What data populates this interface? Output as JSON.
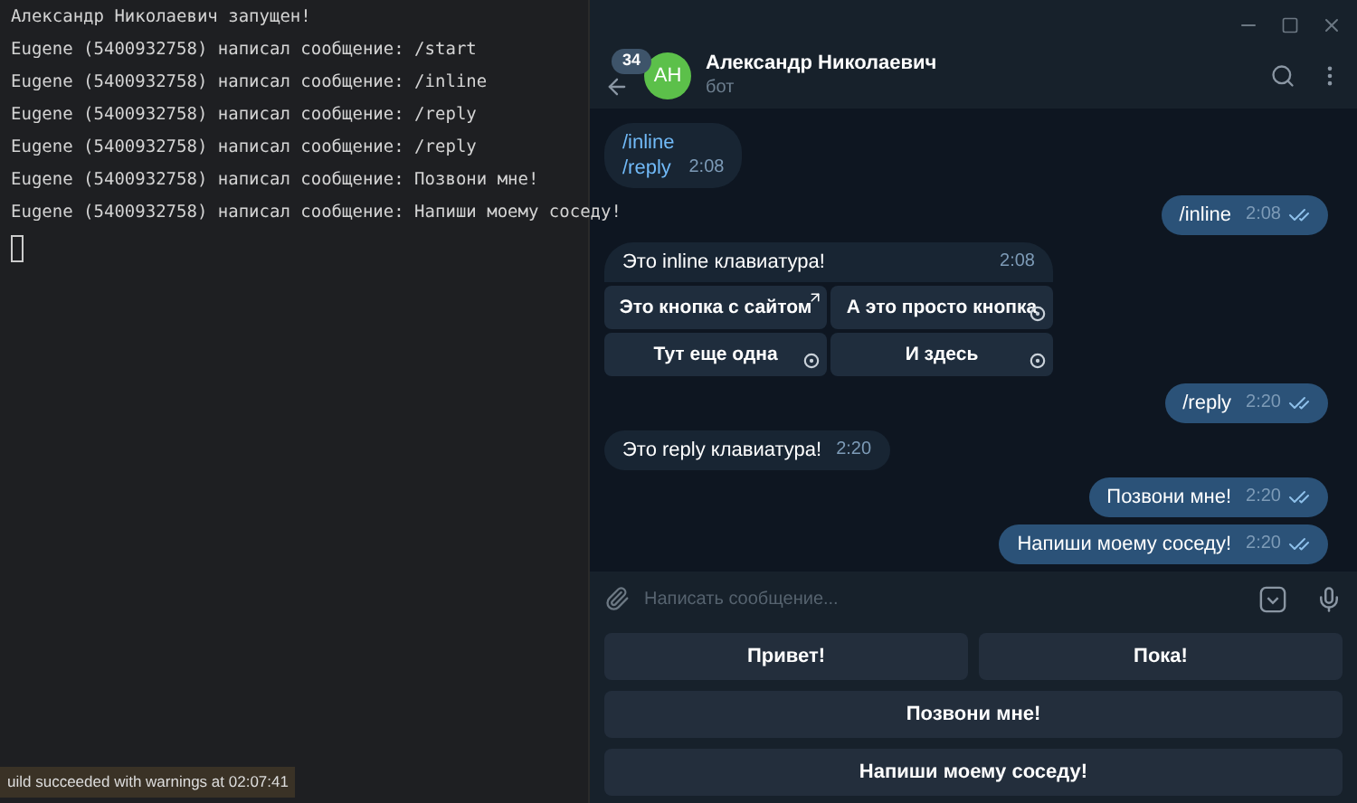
{
  "terminal": {
    "lines": [
      "Александр Николаевич запущен!",
      "Eugene (5400932758) написал сообщение: /start",
      "Eugene (5400932758) написал сообщение: /inline",
      "Eugene (5400932758) написал сообщение: /reply",
      "Eugene (5400932758) написал сообщение: /reply",
      "Eugene (5400932758) написал сообщение: Позвони мне!",
      "Eugene (5400932758) написал сообщение: Напиши моему соседу!"
    ]
  },
  "toast": {
    "text": "uild succeeded with warnings at 02:07:41"
  },
  "chat": {
    "unread_badge": "34",
    "avatar": "АН",
    "name": "Александр Николаевич",
    "status": "бот",
    "messages": [
      {
        "kind": "incoming",
        "lines": [
          "/inline",
          "/reply"
        ],
        "time": "2:08"
      },
      {
        "kind": "outgoing",
        "text": "/inline",
        "time": "2:08",
        "read": true
      },
      {
        "kind": "incoming",
        "text": "Это inline клавиатура!",
        "time": "2:08",
        "buttons": [
          [
            {
              "label": "Это кнопка с сайтом",
              "kind": "url"
            },
            {
              "label": "А это просто кнопка",
              "kind": "callback"
            }
          ],
          [
            {
              "label": "Тут еще одна",
              "kind": "callback"
            },
            {
              "label": "И здесь",
              "kind": "callback"
            }
          ]
        ]
      },
      {
        "kind": "outgoing",
        "text": "/reply",
        "time": "2:20",
        "read": true
      },
      {
        "kind": "incoming",
        "text": "Это reply клавиатура!",
        "time": "2:20"
      },
      {
        "kind": "outgoing",
        "text": "Позвони мне!",
        "time": "2:20",
        "read": true
      },
      {
        "kind": "outgoing",
        "text": "Напиши моему соседу!",
        "time": "2:20",
        "read": true
      }
    ],
    "input": {
      "placeholder": "Написать сообщение..."
    },
    "keyboard": [
      [
        "Привет!",
        "Пока!"
      ],
      [
        "Позвони мне!"
      ],
      [
        "Напиши моему соседу!"
      ]
    ]
  }
}
